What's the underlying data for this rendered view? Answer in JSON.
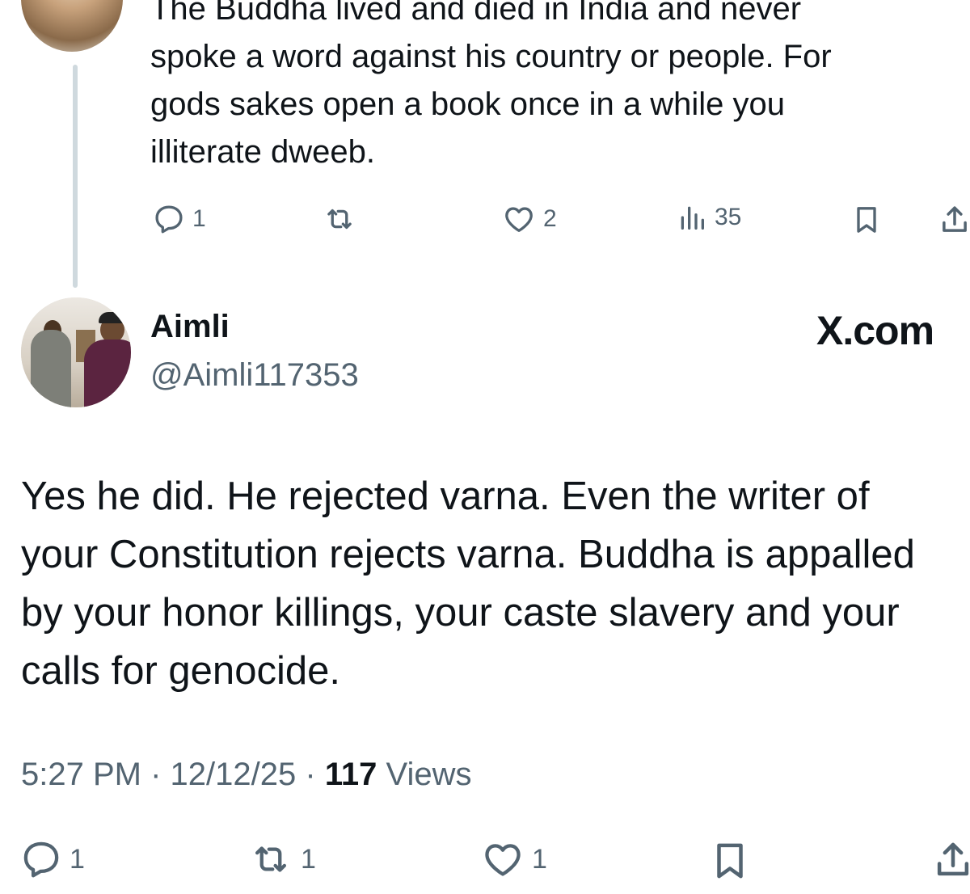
{
  "parent_tweet": {
    "text_lines": [
      "The Buddha lived and died in India and never",
      "spoke a word against his country or people. For",
      "gods sakes open a book once in a while you",
      "illiterate dweeb."
    ],
    "actions": {
      "reply_count": "1",
      "retweet_count": "",
      "like_count": "2",
      "view_count": "35"
    }
  },
  "tweet": {
    "display_name": "Aimli",
    "handle": "@Aimli117353",
    "watermark": "X.com",
    "text_lines": [
      "Yes he did. He rejected varna. Even the writer of",
      "your Constitution rejects varna. Buddha is appalled",
      "by your honor killings, your caste slavery and your",
      "calls for genocide."
    ],
    "time": "5:27 PM",
    "date": "12/12/25",
    "views_count": "117",
    "views_label": "Views",
    "separator": "·",
    "actions": {
      "reply_count": "1",
      "retweet_count": "1",
      "like_count": "1"
    }
  },
  "colors": {
    "text": "#0f1419",
    "secondary": "#536471",
    "thread_line": "#cfd9de",
    "background": "#ffffff"
  },
  "icons": [
    "reply-icon",
    "retweet-icon",
    "like-icon",
    "views-icon",
    "bookmark-icon",
    "share-icon"
  ]
}
